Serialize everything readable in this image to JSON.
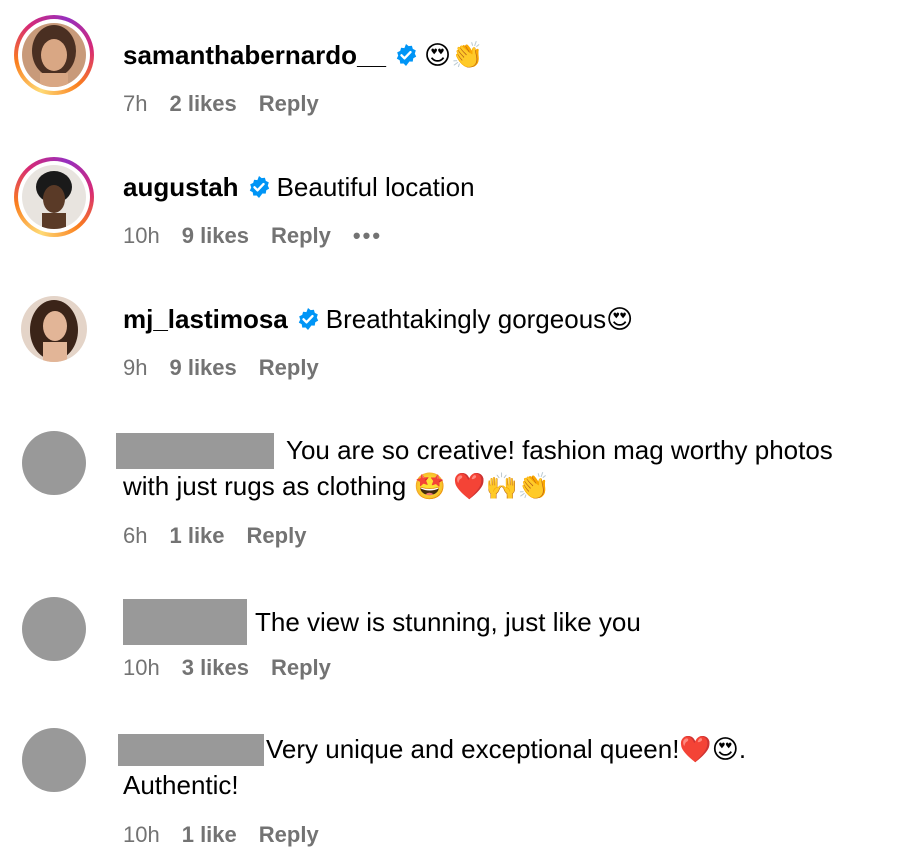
{
  "comments": [
    {
      "username": "samanthabernardo__",
      "verified": true,
      "text": "😍👏",
      "time": "7h",
      "likes": "2 likes",
      "reply": "Reply"
    },
    {
      "username": "augustah",
      "verified": true,
      "text": "Beautiful location",
      "time": "10h",
      "likes": "9 likes",
      "reply": "Reply",
      "more": "•••"
    },
    {
      "username": "mj_lastimosa",
      "verified": true,
      "text": "Breathtakingly gorgeous😍",
      "time": "9h",
      "likes": "9 likes",
      "reply": "Reply"
    },
    {
      "username_redacted": true,
      "text_line1": "You are so creative! fashion mag worthy photos",
      "text_line2": "with just rugs as clothing 🤩 ❤️🙌👏",
      "time": "6h",
      "likes": "1 like",
      "reply": "Reply"
    },
    {
      "username_redacted": true,
      "text": "The view is stunning, just like you",
      "time": "10h",
      "likes": "3 likes",
      "reply": "Reply"
    },
    {
      "username_redacted": true,
      "text_line1": "Very unique and exceptional queen!❤️😍.",
      "text_line2": "Authentic!",
      "time": "10h",
      "likes": "1 like",
      "reply": "Reply"
    }
  ],
  "colors": {
    "meta_gray": "#737373",
    "verified_blue": "#0095f6",
    "redaction_gray": "#999999"
  }
}
